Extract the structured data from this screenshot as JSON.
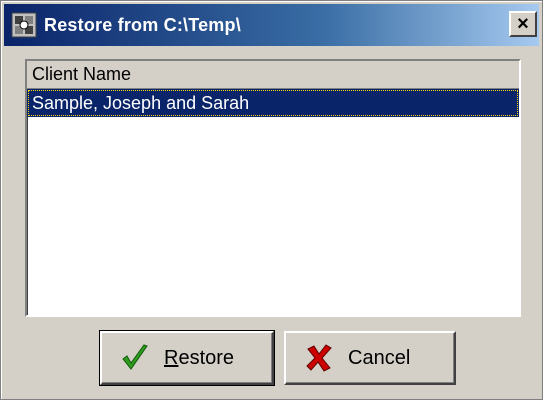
{
  "window": {
    "title": "Restore from C:\\Temp\\",
    "close_glyph": "×"
  },
  "list": {
    "header": "Client Name",
    "items": [
      {
        "label": "Sample, Joseph and Sarah",
        "selected": true
      }
    ]
  },
  "buttons": {
    "restore": {
      "mnemonic": "R",
      "rest": "estore",
      "icon": "checkmark-icon",
      "icon_color": "#2e9b1e"
    },
    "cancel": {
      "label": "Cancel",
      "icon": "x-icon",
      "icon_color": "#cc0000"
    }
  },
  "colors": {
    "titlebar_start": "#0a246a",
    "titlebar_end": "#a6caf0",
    "selection": "#0a246a",
    "face": "#d4d0c8"
  }
}
